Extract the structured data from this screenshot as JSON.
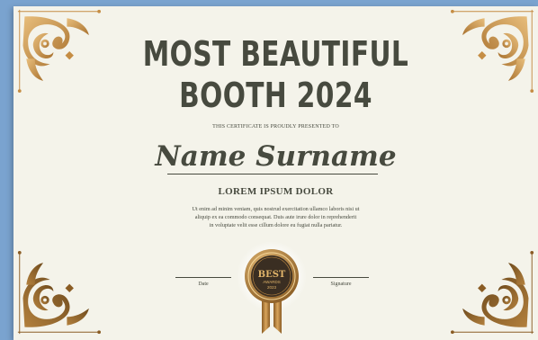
{
  "certificate": {
    "title_line1": "MOST BEAUTIFUL",
    "title_line2": "BOOTH 2024",
    "presented_text": "THIS CERTIFICATE IS PROUDLY PRESENTED TO",
    "recipient_name": "Name Surname",
    "subtitle": "LOREM IPSUM DOLOR",
    "body_line1": "Ut enim ad minim veniam, quis nostrud exercitation ullamco laboris nisi ut",
    "body_line2": "aliquip ex ea commodo consequat. Duis aute irure dolor in reprehenderit",
    "body_line3": "in voluptate velit esse cillum dolore eu fugiat nulla pariatur.",
    "date_label": "Date",
    "signature_label": "Signature"
  },
  "seal": {
    "line1": "BEST",
    "line2": "AWARDS",
    "line3": "2023"
  },
  "colors": {
    "background": "#7aa3cf",
    "paper": "#f4f3ea",
    "text": "#474a3f",
    "gold_light": "#d9a55c",
    "gold_dark": "#8a5c24"
  },
  "icons": [
    "corner-ornament-icon",
    "award-seal-icon"
  ]
}
